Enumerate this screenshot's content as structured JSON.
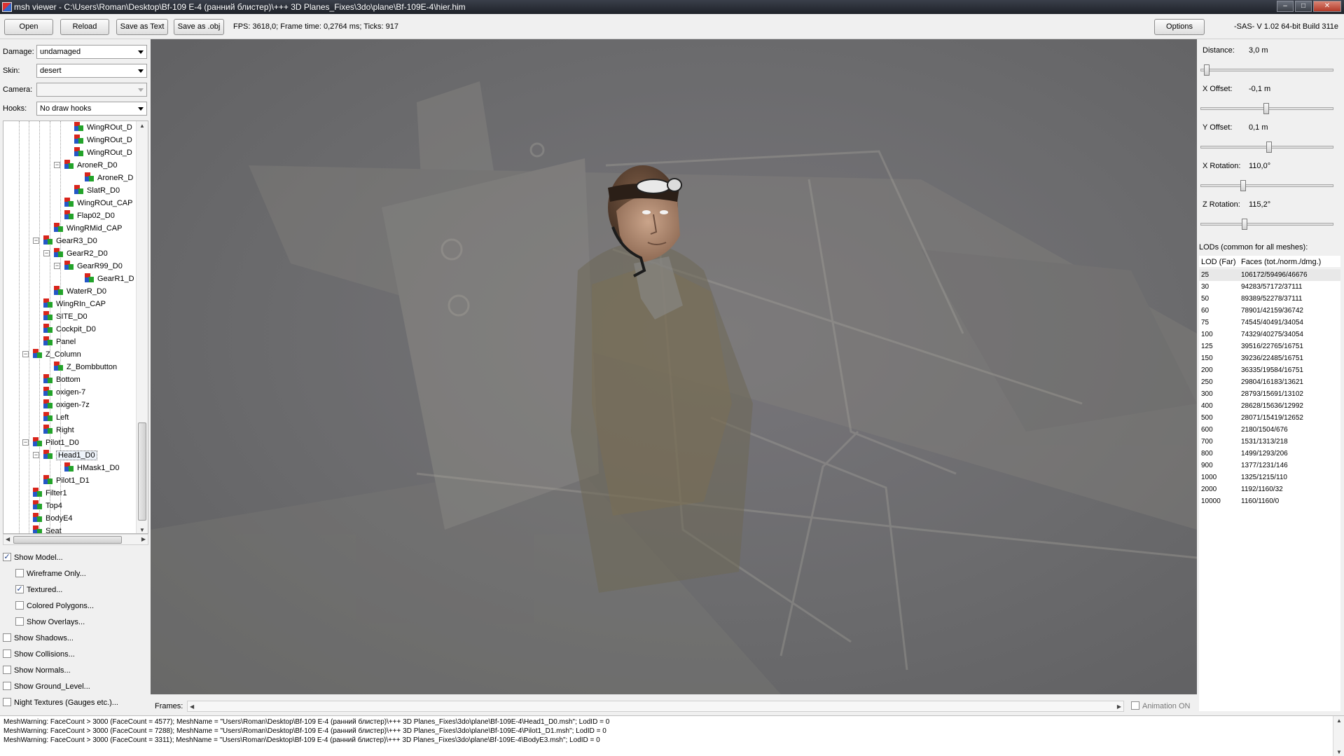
{
  "window": {
    "title": "msh viewer - C:\\Users\\Roman\\Desktop\\Bf-109 E-4 (ранний блистер)\\+++ 3D Planes_Fixes\\3do\\plane\\Bf-109E-4\\hier.him",
    "controls": {
      "minimize": "–",
      "maximize": "□",
      "close": "✕"
    }
  },
  "toolbar": {
    "open": "Open",
    "reload": "Reload",
    "save_text": "Save as Text",
    "save_obj": "Save as .obj",
    "stats": "FPS: 3618,0; Frame time: 0,2764 ms; Ticks: 917",
    "options": "Options",
    "version": "-SAS- V 1.02  64-bit  Build 311e"
  },
  "left": {
    "damage": {
      "label": "Damage:",
      "value": "undamaged"
    },
    "skin": {
      "label": "Skin:",
      "value": "desert"
    },
    "camera": {
      "label": "Camera:",
      "value": ""
    },
    "hooks": {
      "label": "Hooks:",
      "value": "No draw hooks"
    },
    "tree": [
      {
        "label": "WingROut_D"
      },
      {
        "label": "WingROut_D"
      },
      {
        "label": "WingROut_D"
      },
      {
        "label": "AroneR_D0"
      },
      {
        "label": "AroneR_D"
      },
      {
        "label": "SlatR_D0"
      },
      {
        "label": "WingROut_CAP"
      },
      {
        "label": "Flap02_D0"
      },
      {
        "label": "WingRMid_CAP"
      },
      {
        "label": "GearR3_D0"
      },
      {
        "label": "GearR2_D0"
      },
      {
        "label": "GearR99_D0"
      },
      {
        "label": "GearR1_D"
      },
      {
        "label": "WaterR_D0"
      },
      {
        "label": "WingRIn_CAP"
      },
      {
        "label": "SITE_D0"
      },
      {
        "label": "Cockpit_D0"
      },
      {
        "label": "Panel"
      },
      {
        "label": "Z_Column"
      },
      {
        "label": "Z_Bombbutton"
      },
      {
        "label": "Bottom"
      },
      {
        "label": "oxigen-7"
      },
      {
        "label": "oxigen-7z"
      },
      {
        "label": "Left"
      },
      {
        "label": "Right"
      },
      {
        "label": "Pilot1_D0"
      },
      {
        "label": "Head1_D0"
      },
      {
        "label": "HMask1_D0"
      },
      {
        "label": "Pilot1_D1"
      },
      {
        "label": "Filter1"
      },
      {
        "label": "Top4"
      },
      {
        "label": "BodyE4"
      },
      {
        "label": "Seat"
      }
    ],
    "checks": [
      {
        "label": "Show Model...",
        "checked": "✓"
      },
      {
        "label": "Wireframe Only...",
        "checked": ""
      },
      {
        "label": "Textured...",
        "checked": "✓"
      },
      {
        "label": "Colored Polygons...",
        "checked": ""
      },
      {
        "label": "Show Overlays...",
        "checked": ""
      },
      {
        "label": "Show Shadows...",
        "checked": ""
      },
      {
        "label": "Show Collisions...",
        "checked": ""
      },
      {
        "label": "Show Normals...",
        "checked": ""
      },
      {
        "label": "Show Ground_Level...",
        "checked": ""
      },
      {
        "label": "Night Textures (Gauges etc.)...",
        "checked": ""
      }
    ]
  },
  "frames": {
    "label": "Frames:",
    "animation": "Animation ON"
  },
  "right": {
    "sliders": [
      {
        "label": "Distance:",
        "value": "3,0 m",
        "pos": 0.02
      },
      {
        "label": "X Offset:",
        "value": "-0,1 m",
        "pos": 0.49
      },
      {
        "label": "Y Offset:",
        "value": "0,1 m",
        "pos": 0.51
      },
      {
        "label": "X Rotation:",
        "value": "110,0°",
        "pos": 0.31
      },
      {
        "label": "Z Rotation:",
        "value": "115,2°",
        "pos": 0.32
      }
    ],
    "lods_title": "LODs (common for all meshes):",
    "lod_headers": {
      "far": "LOD (Far)",
      "faces": "Faces (tot./norm./dmg.)"
    },
    "lods": [
      {
        "far": "25",
        "faces": "106172/59496/46676"
      },
      {
        "far": "30",
        "faces": "94283/57172/37111"
      },
      {
        "far": "50",
        "faces": "89389/52278/37111"
      },
      {
        "far": "60",
        "faces": "78901/42159/36742"
      },
      {
        "far": "75",
        "faces": "74545/40491/34054"
      },
      {
        "far": "100",
        "faces": "74329/40275/34054"
      },
      {
        "far": "125",
        "faces": "39516/22765/16751"
      },
      {
        "far": "150",
        "faces": "39236/22485/16751"
      },
      {
        "far": "200",
        "faces": "36335/19584/16751"
      },
      {
        "far": "250",
        "faces": "29804/16183/13621"
      },
      {
        "far": "300",
        "faces": "28793/15691/13102"
      },
      {
        "far": "400",
        "faces": "28628/15636/12992"
      },
      {
        "far": "500",
        "faces": "28071/15419/12652"
      },
      {
        "far": "600",
        "faces": "2180/1504/676"
      },
      {
        "far": "700",
        "faces": "1531/1313/218"
      },
      {
        "far": "800",
        "faces": "1499/1293/206"
      },
      {
        "far": "900",
        "faces": "1377/1231/146"
      },
      {
        "far": "1000",
        "faces": "1325/1215/110"
      },
      {
        "far": "2000",
        "faces": "1192/1160/32"
      },
      {
        "far": "10000",
        "faces": "1160/1160/0"
      }
    ]
  },
  "log": [
    "MeshWarning: FaceCount > 3000 (FaceCount = 4577); MeshName = \"Users\\Roman\\Desktop\\Bf-109 E-4 (ранний блистер)\\+++ 3D Planes_Fixes\\3do\\plane\\Bf-109E-4\\Head1_D0.msh\"; LodID = 0",
    "MeshWarning: FaceCount > 3000 (FaceCount = 7288); MeshName = \"Users\\Roman\\Desktop\\Bf-109 E-4 (ранний блистер)\\+++ 3D Planes_Fixes\\3do\\plane\\Bf-109E-4\\Pilot1_D1.msh\"; LodID = 0",
    "MeshWarning: FaceCount > 3000 (FaceCount = 3311); MeshName = \"Users\\Roman\\Desktop\\Bf-109 E-4 (ранний блистер)\\+++ 3D Planes_Fixes\\3do\\plane\\Bf-109E-4\\BodyE3.msh\"; LodID = 0"
  ]
}
